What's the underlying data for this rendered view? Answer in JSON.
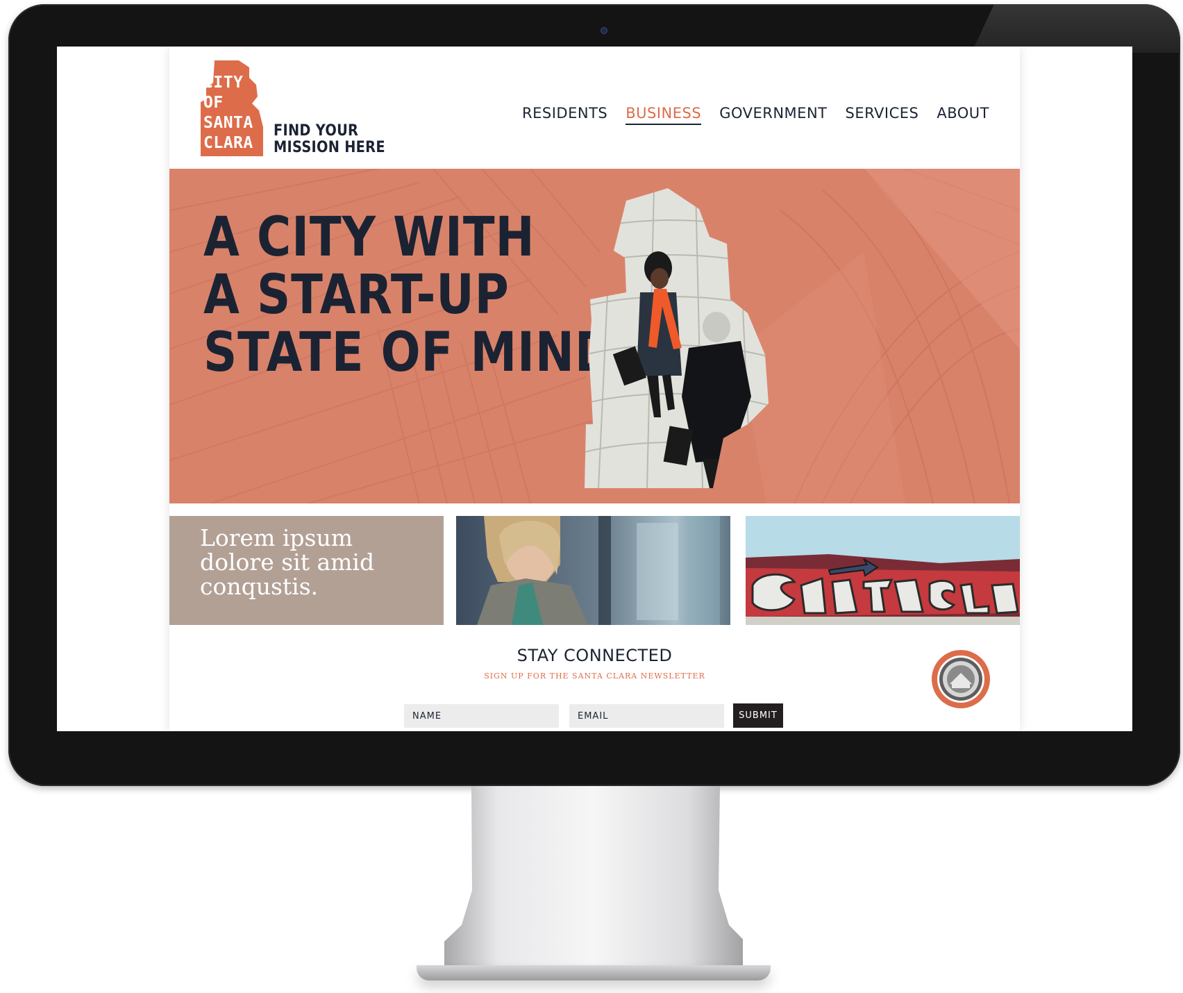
{
  "brand": {
    "logo_lines": [
      "CITY",
      "OF",
      "SANTA",
      "CLARA"
    ],
    "tagline_lines": [
      "FIND YOUR",
      "MISSION HERE"
    ],
    "accent_color": "#dd6c4a",
    "navy_color": "#1b2333"
  },
  "nav": {
    "items": [
      {
        "label": "RESIDENTS",
        "active": false
      },
      {
        "label": "BUSINESS",
        "active": true
      },
      {
        "label": "GOVERNMENT",
        "active": false
      },
      {
        "label": "SERVICES",
        "active": false
      },
      {
        "label": "ABOUT",
        "active": false
      }
    ]
  },
  "hero": {
    "title_lines": [
      "A CITY WITH",
      "A START-UP",
      "STATE OF MIND"
    ]
  },
  "tiles": {
    "quote": "Lorem ipsum dolore sit amid conqustis."
  },
  "newsletter": {
    "title": "STAY CONNECTED",
    "subtitle": "SIGN UP FOR THE SANTA CLARA NEWSLETTER",
    "name_placeholder": "NAME",
    "email_placeholder": "EMAIL",
    "submit_label": "SUBMIT"
  }
}
